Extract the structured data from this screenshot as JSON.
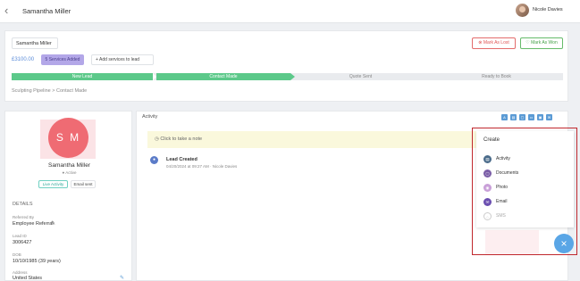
{
  "header": {
    "title": "Samantha Miller",
    "user_name": "Nicole Davies"
  },
  "lead": {
    "name_value": "Samantha Miller",
    "mark_lost": "Mark As Lost",
    "mark_won": "Mark As Won",
    "price": "£3100.00",
    "services_badge": "5 Services Added",
    "add_services": "Add services to lead"
  },
  "pipeline": {
    "stages": [
      {
        "label": "New Lead"
      },
      {
        "label": "Contact Made"
      },
      {
        "label": "Quote Sent"
      },
      {
        "label": "Ready to Book"
      }
    ],
    "breadcrumb": "Sculpting Pipeline  >  Contact Made"
  },
  "profile": {
    "initials": "S M",
    "name": "Samantha   Miller",
    "status": "Active",
    "chip_call": "Live Activity",
    "chip_email": "Email sent",
    "details_heading": "DETAILS",
    "fields": [
      {
        "label": "Referred By",
        "value": "Employee Referral"
      },
      {
        "label": "Lead ID",
        "value": "3006427"
      },
      {
        "label": "DOB",
        "value": "10/10/1985 (39 years)"
      },
      {
        "label": "Address",
        "value": "United States"
      }
    ]
  },
  "activity": {
    "title": "Activity",
    "note_placeholder": "Click to take a note",
    "events": [
      {
        "title": "Lead Created",
        "date": "04/20/2024 at 09:27 AM",
        "author": "Nicole Davies"
      }
    ]
  },
  "create_menu": {
    "title": "Create",
    "items": [
      {
        "label": "Activity",
        "icon": "clipboard-icon",
        "color": "#4a6b8a"
      },
      {
        "label": "Documents",
        "icon": "document-icon",
        "color": "#7b5ea7"
      },
      {
        "label": "Photo",
        "icon": "camera-icon",
        "color": "#c9a0d8"
      },
      {
        "label": "Email",
        "icon": "envelope-icon",
        "color": "#6b4fb0"
      },
      {
        "label": "SMS",
        "icon": "chat-icon",
        "color": "#cccccc"
      }
    ]
  },
  "colors": {
    "accent": "#5cc98a",
    "brand": "#5aa6e6",
    "danger": "#e05555"
  }
}
